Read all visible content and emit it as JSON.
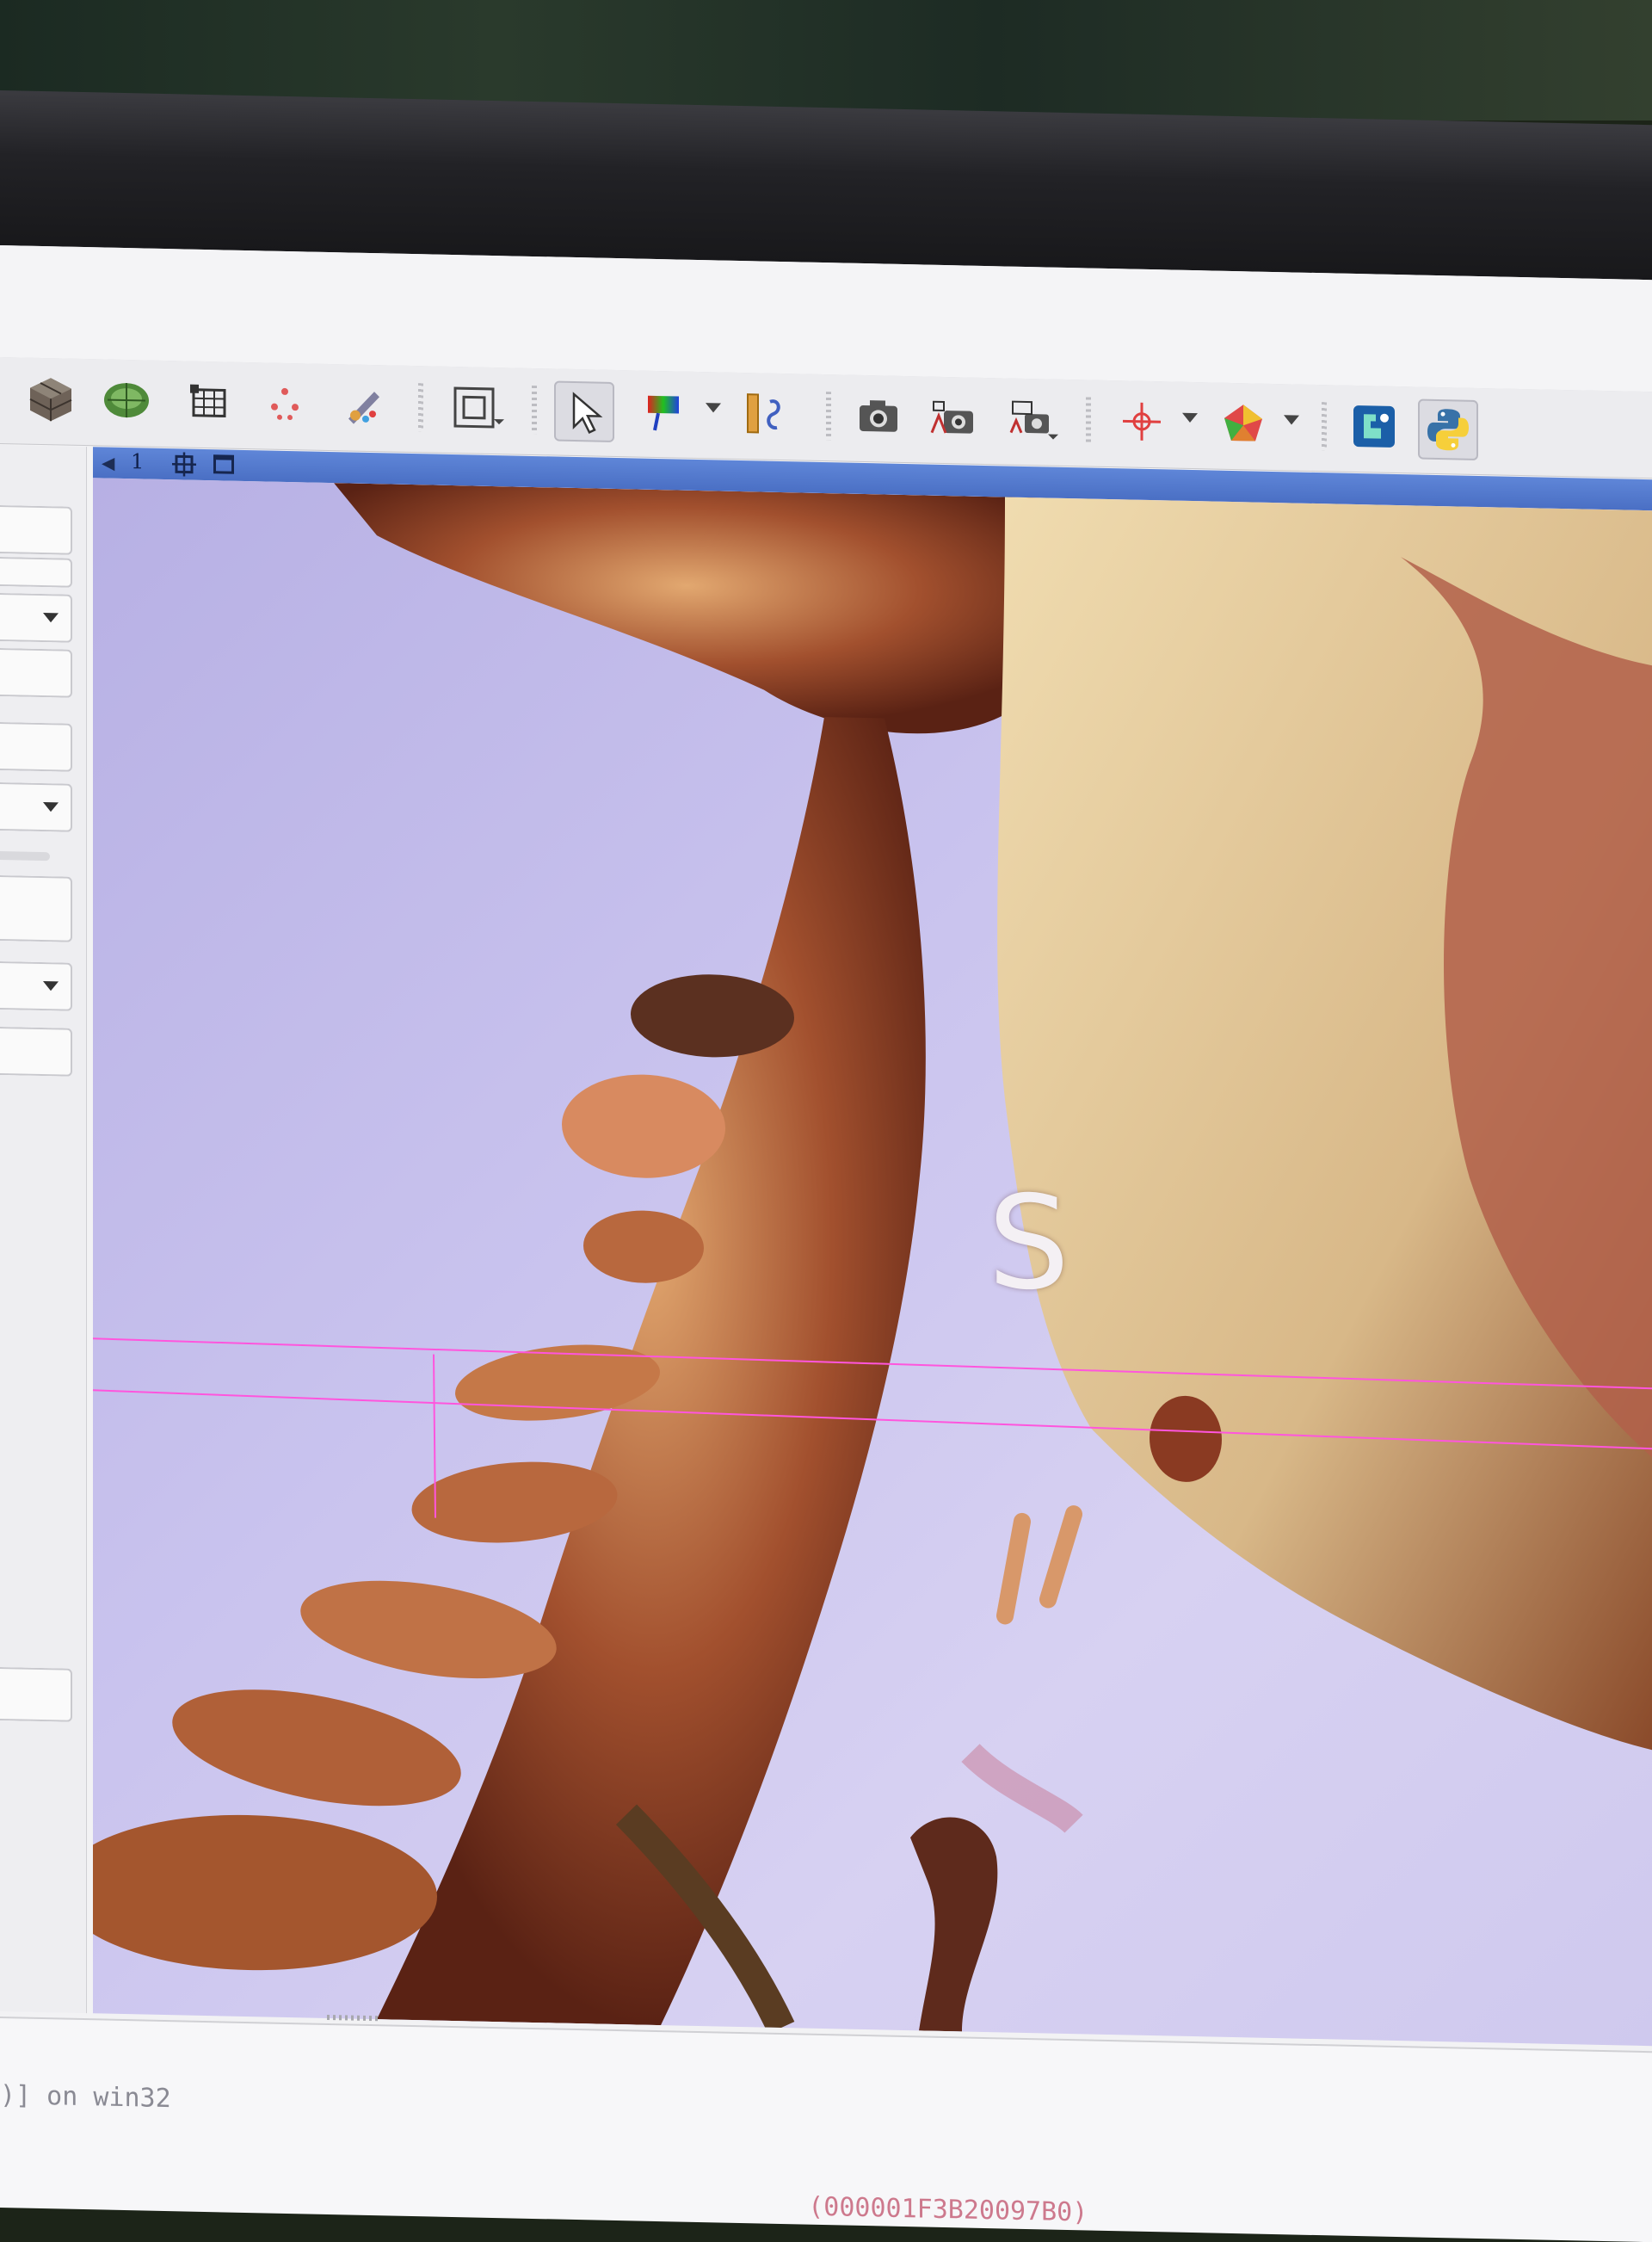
{
  "toolbar": {
    "icons": [
      "data-cube-icon",
      "volume-render-icon",
      "grid-table-icon",
      "markups-points-icon",
      "segment-editor-brush-icon",
      "window-fit-icon",
      "pointer-arrow-icon",
      "colormap-icon",
      "ruler-icon",
      "capture-screenshot-icon",
      "capture-scene-icon",
      "scene-views-icon",
      "crosshair-icon",
      "layout-cube-icon",
      "extension-manager-icon",
      "python-icon"
    ]
  },
  "view": {
    "number": "1",
    "orientation_label": "S"
  },
  "console": {
    "line1": ")] on win32",
    "line2": "                                                    (000001F3B20097B0)"
  },
  "colors": {
    "view_titlebar": "#5f86d8",
    "render_background": "#c9c3ee",
    "bone": "#9a4a2c",
    "crosshair": "#ff55dd"
  }
}
